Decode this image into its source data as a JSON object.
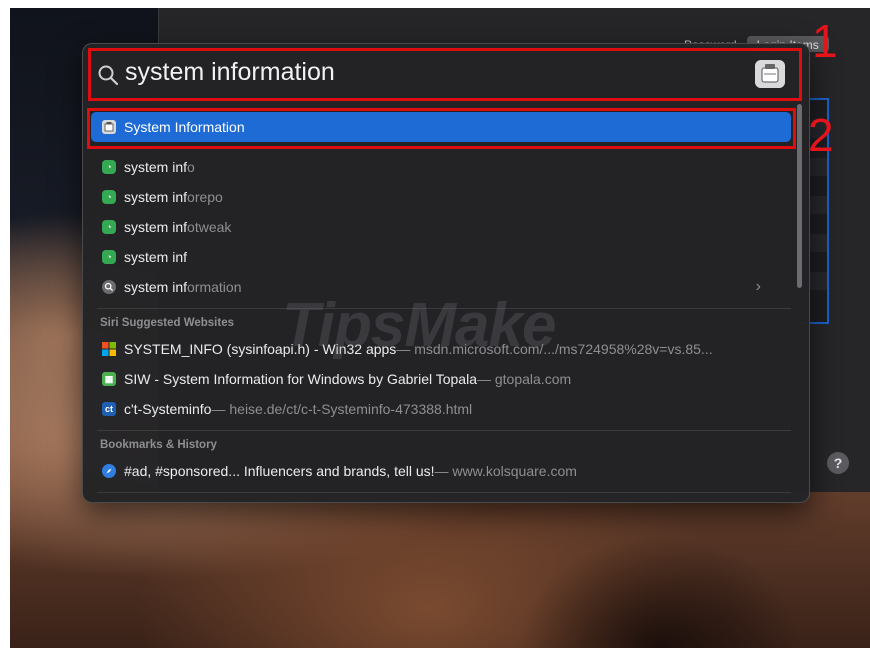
{
  "background_window": {
    "segmented_tabs": [
      "Password",
      "Login Items"
    ],
    "help_button": "?"
  },
  "spotlight": {
    "query_typed": "system inf",
    "query_completion": "ormation",
    "top_hit": {
      "label": "System Information"
    },
    "suggestions": [
      {
        "typed": "system inf",
        "bold": "o",
        "rest": "",
        "icon": "siri-suggestion-icon"
      },
      {
        "typed": "system inf",
        "bold": "o",
        "rest": " repo",
        "icon": "siri-suggestion-icon"
      },
      {
        "typed": "system inf",
        "bold": "o",
        "rest": " tweak",
        "icon": "siri-suggestion-icon"
      },
      {
        "typed": "system inf",
        "bold": "",
        "rest": "",
        "icon": "siri-suggestion-icon"
      },
      {
        "typed": "system inf",
        "bold": "",
        "rest": "ormation",
        "icon": "search-web-icon"
      }
    ],
    "sections": {
      "websites": "Siri Suggested Websites",
      "bookmarks": "Bookmarks & History"
    },
    "websites": [
      {
        "title": "SYSTEM_INFO (sysinfoapi.h) - Win32 apps",
        "url": " — msdn.microsoft.com/.../ms724958%28v=vs.85...",
        "icon": "microsoft-icon"
      },
      {
        "title": "SIW - System Information for Windows by Gabriel Topala",
        "url": " — gtopala.com",
        "icon": "siw-icon"
      },
      {
        "title": "c't-Systeminfo",
        "url": " — heise.de/ct/c-t-Systeminfo-473388.html",
        "icon": "ct-icon"
      }
    ],
    "bookmarks": [
      {
        "title": "#ad, #sponsored... Influencers and brands, tell us!",
        "url": " — www.kolsquare.com",
        "icon": "safari-icon"
      }
    ]
  },
  "annotations": {
    "box1_number": "1",
    "box2_number": "2"
  },
  "watermark": "TipsMake",
  "colors": {
    "selection": "#1e6bd6",
    "annotation": "#dd0d10"
  }
}
